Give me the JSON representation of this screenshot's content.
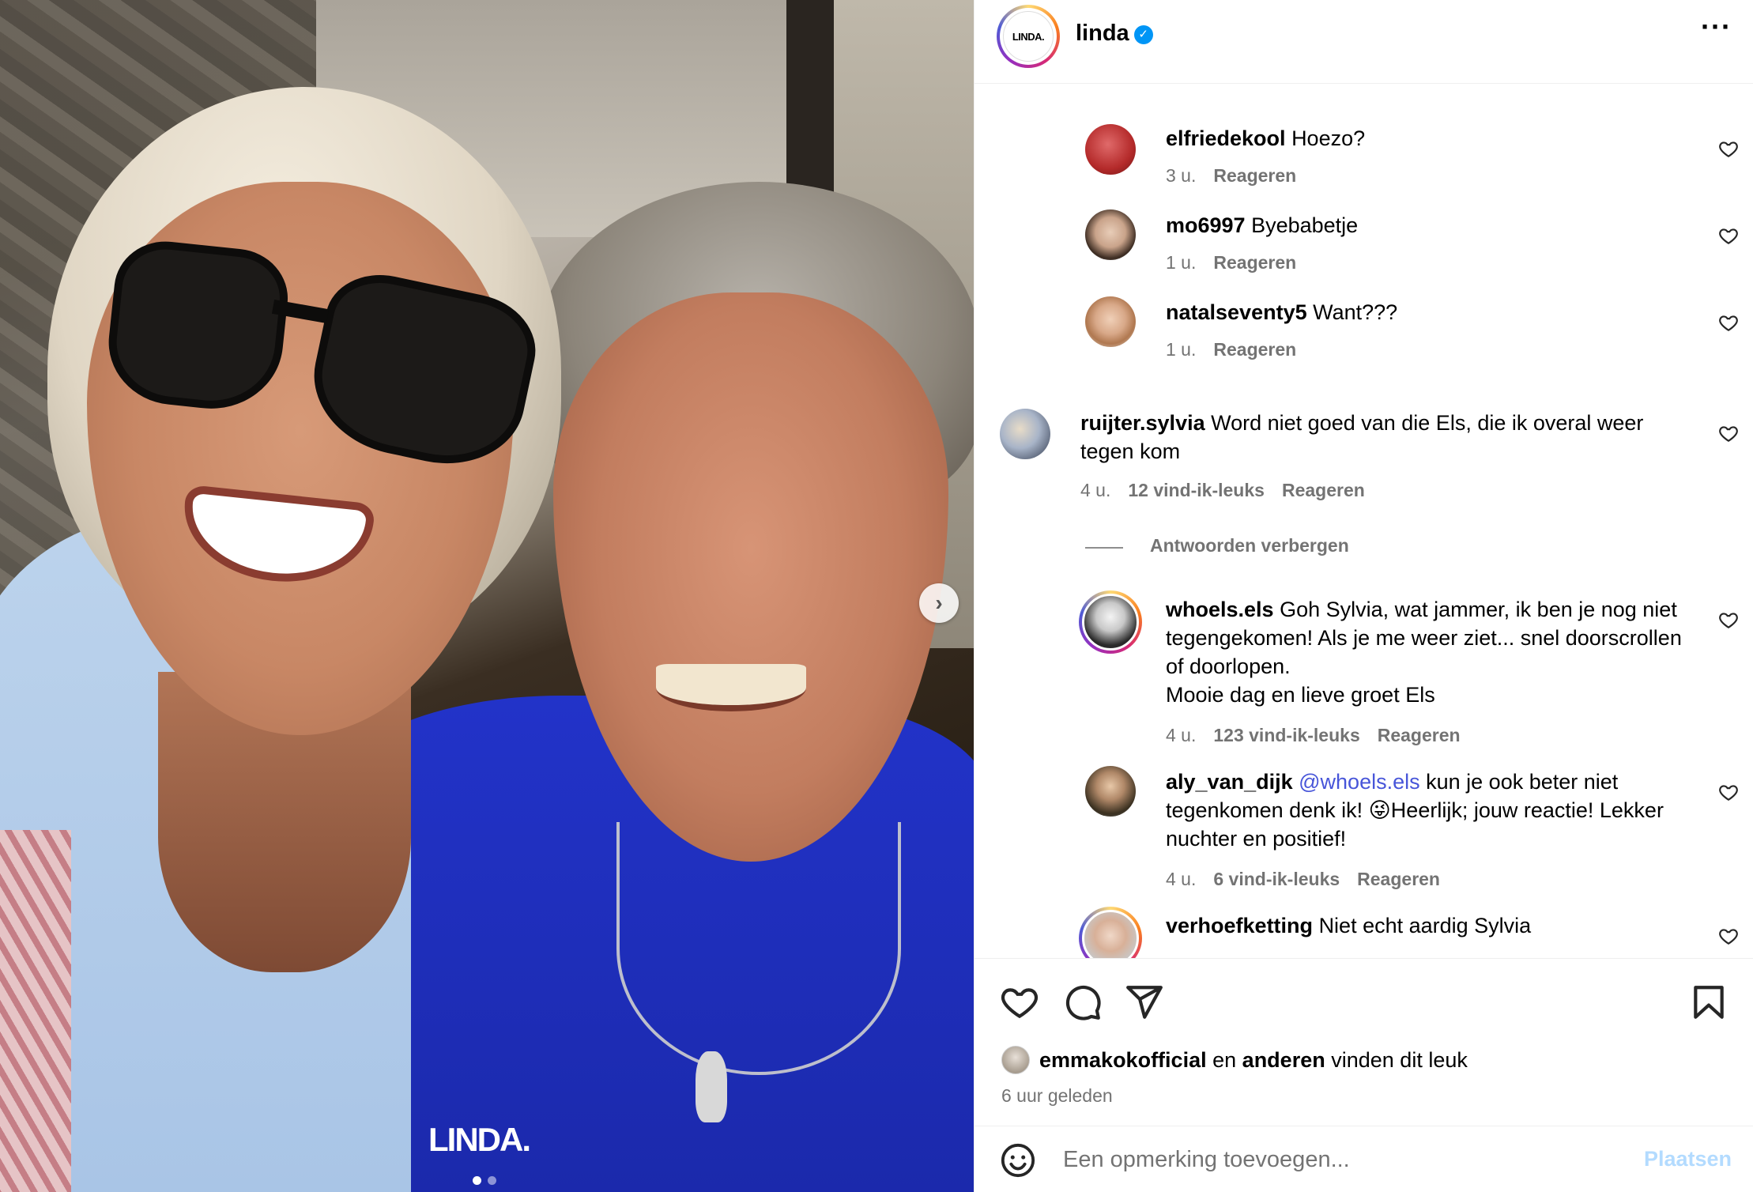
{
  "post": {
    "image": {
      "watermark": "LINDA.",
      "slide_count": 2,
      "active_slide": 1
    }
  },
  "header": {
    "username": "linda",
    "avatar_logo": "LINDA.",
    "verified_icon": "verified-badge-icon",
    "more_icon": "more-options-icon"
  },
  "comments": [
    {
      "username": "elfriedekool",
      "text": "Hoezo?",
      "time": "3 u.",
      "likes": "",
      "reply": "Reageren"
    },
    {
      "username": "mo6997",
      "text": "Byebabetje",
      "time": "1 u.",
      "likes": "",
      "reply": "Reageren"
    },
    {
      "username": "natalseventy5",
      "text": "Want???",
      "time": "1 u.",
      "likes": "",
      "reply": "Reageren"
    },
    {
      "username": "ruijter.sylvia",
      "text": "Word niet goed van die Els, die ik overal weer tegen kom",
      "time": "4 u.",
      "likes": "12 vind-ik-leuks",
      "reply": "Reageren"
    },
    {
      "username": "whoels.els",
      "text": "Goh Sylvia, wat jammer, ik ben je nog niet tegengekomen! Als je me weer ziet... snel doorscrollen of doorlopen.",
      "text2": "Mooie dag en lieve groet Els",
      "time": "4 u.",
      "likes": "123 vind-ik-leuks",
      "reply": "Reageren"
    },
    {
      "username": "aly_van_dijk",
      "mention": "@whoels.els",
      "text": "kun je ook beter niet tegenkomen denk ik! 😜Heerlijk; jouw reactie! Lekker nuchter en positief!",
      "time": "4 u.",
      "likes": "6 vind-ik-leuks",
      "reply": "Reageren"
    },
    {
      "username": "verhoefketting",
      "text": "Niet echt aardig Sylvia",
      "time": "",
      "likes": "",
      "reply": ""
    }
  ],
  "hide_replies": "Antwoorden verbergen",
  "actions": {
    "like_icon": "heart-icon",
    "comment_icon": "comment-icon",
    "share_icon": "send-icon",
    "save_icon": "bookmark-icon"
  },
  "likes": {
    "user": "emmakokofficial",
    "connector": "en",
    "others": "anderen",
    "suffix": "vinden dit leuk"
  },
  "posted_ago": "6 uur geleden",
  "add_comment": {
    "placeholder": "Een opmerking toevoegen...",
    "post_label": "Plaatsen",
    "emoji_icon": "emoji-icon"
  },
  "colors": {
    "accent_blue": "#0095f6",
    "mention_blue": "#4755d9",
    "muted_text": "#737373",
    "post_disabled": "#b3dbff"
  }
}
